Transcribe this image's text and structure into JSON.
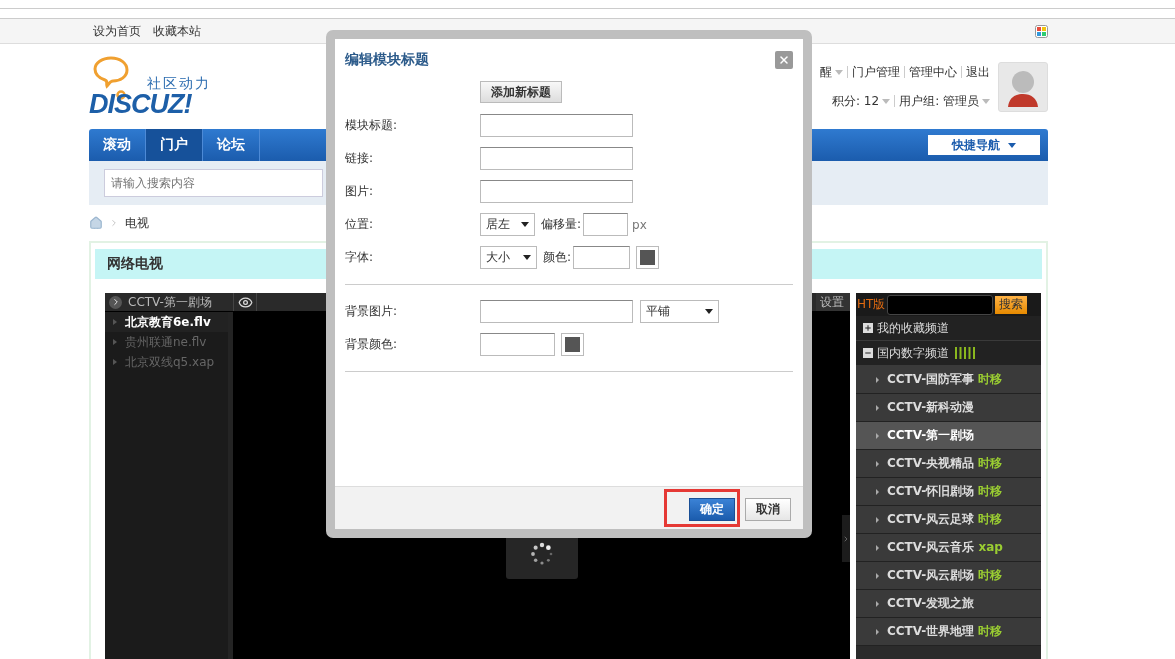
{
  "toolbar": {
    "links": [
      "设为首页",
      "收藏本站"
    ]
  },
  "logo": {
    "tagline": "社区动力",
    "wordmark": "DISCUZ!"
  },
  "user": {
    "row1": [
      {
        "label": "醒",
        "dropdown": true
      },
      {
        "label": "门户管理",
        "dropdown": false
      },
      {
        "label": "管理中心",
        "dropdown": false
      },
      {
        "label": "退出",
        "dropdown": false
      }
    ],
    "row2": [
      {
        "label": "积分: 12",
        "dropdown": true
      },
      {
        "label": "用户组: 管理员",
        "dropdown": true
      }
    ]
  },
  "nav": {
    "items": [
      {
        "label": "滚动",
        "selected": false
      },
      {
        "label": "门户",
        "selected": true
      },
      {
        "label": "论坛",
        "selected": false
      }
    ],
    "quick_nav": "快捷导航"
  },
  "search": {
    "placeholder": "请输入搜索内容"
  },
  "breadcrumb": {
    "current": "电视"
  },
  "section": {
    "title": "网络电视"
  },
  "player": {
    "channel_title": "CCTV-第一剧场",
    "settings": "设置",
    "playlist": [
      {
        "label": "北京教育6e.flv",
        "selected": true
      },
      {
        "label": "贵州联通ne.flv",
        "selected": false
      },
      {
        "label": "北京双线q5.xap",
        "selected": false
      }
    ],
    "panel": {
      "brand": "HT版",
      "search_button": "搜索",
      "groups": [
        {
          "label": "我的收藏频道",
          "expanded": false
        },
        {
          "label": "国内数字频道",
          "expanded": true
        }
      ],
      "channels": [
        {
          "name": "CCTV-国防军事",
          "tag": "时移",
          "selected": false
        },
        {
          "name": "CCTV-新科动漫",
          "selected": false
        },
        {
          "name": "CCTV-第一剧场",
          "selected": true
        },
        {
          "name": "CCTV-央视精品",
          "tag": "时移",
          "selected": false
        },
        {
          "name": "CCTV-怀旧剧场",
          "tag": "时移",
          "selected": false
        },
        {
          "name": "CCTV-风云足球",
          "tag": "时移",
          "selected": false
        },
        {
          "name": "CCTV-风云音乐",
          "tag": "xap",
          "selected": false
        },
        {
          "name": "CCTV-风云剧场",
          "tag": "时移",
          "selected": false
        },
        {
          "name": "CCTV-发现之旅",
          "selected": false
        },
        {
          "name": "CCTV-世界地理",
          "tag": "时移",
          "selected": false
        }
      ]
    }
  },
  "dialog": {
    "title": "编辑模块标题",
    "add_button": "添加新标题",
    "sections": [
      [
        {
          "kind": "text",
          "label": "模块标题:"
        },
        {
          "kind": "text",
          "label": "链接:"
        },
        {
          "kind": "text",
          "label": "图片:"
        },
        {
          "kind": "position",
          "label": "位置:",
          "select": "居左",
          "offset_label": "偏移量:",
          "unit": "px"
        },
        {
          "kind": "font",
          "label": "字体:",
          "select": "大小",
          "color_label": "颜色:"
        }
      ],
      [
        {
          "kind": "image",
          "label": "背景图片:",
          "select": "平铺"
        },
        {
          "kind": "color",
          "label": "背景颜色:"
        }
      ]
    ],
    "buttons": [
      {
        "label": "确定",
        "kind": "primary",
        "highlighted": true
      },
      {
        "label": "取消",
        "kind": "default",
        "highlighted": false
      }
    ]
  }
}
